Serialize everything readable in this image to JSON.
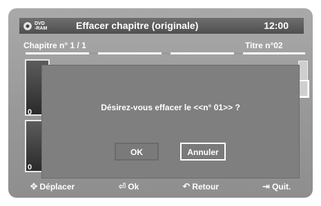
{
  "header": {
    "disc_type_line1": "DVD",
    "disc_type_line2": "-RAM",
    "title": "Effacer chapitre (originale)",
    "clock": "12:00"
  },
  "chapter_label": "Chapitre n° 1 / 1",
  "title_label": "Titre n°02",
  "thumbnails": [
    {
      "number": "0"
    },
    {
      "number": "0"
    }
  ],
  "dialog": {
    "message": "Désirez-vous effacer le <<n° 01>> ?",
    "ok_label": "OK",
    "cancel_label": "Annuler"
  },
  "bottom_bar": {
    "move_label": "Déplacer",
    "ok_label": "Ok",
    "return_label": "Retour",
    "quit_label": "Quit."
  },
  "icons": {
    "move": "four-way-arrows-icon",
    "ok": "enter-icon",
    "return": "return-arrow-icon",
    "quit": "exit-door-icon"
  }
}
